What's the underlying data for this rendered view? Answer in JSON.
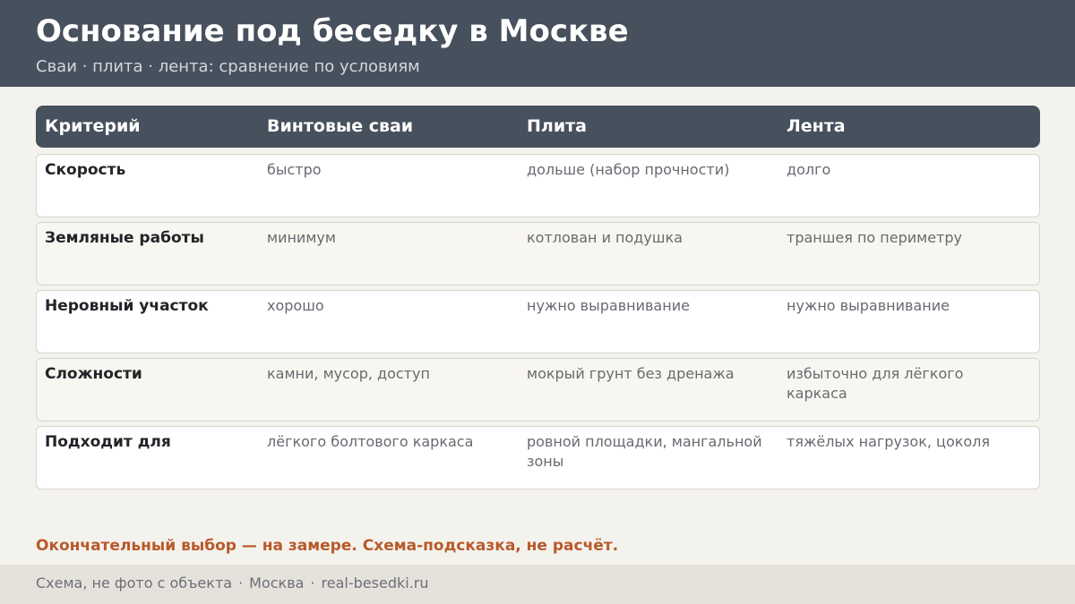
{
  "header": {
    "title": "Основание под беседку в Москве",
    "subtitle": "Сваи · плита · лента: сравнение по условиям"
  },
  "table": {
    "columns": [
      "Критерий",
      "Винтовые сваи",
      "Плита",
      "Лента"
    ],
    "rows": [
      [
        "Скорость",
        "быстро",
        "дольше (набор прочности)",
        "долго"
      ],
      [
        "Земляные работы",
        "минимум",
        "котлован и подушка",
        "траншея по периметру"
      ],
      [
        "Неровный участок",
        "хорошо",
        "нужно выравнивание",
        "нужно выравнивание"
      ],
      [
        "Сложности",
        "камни, мусор, доступ",
        "мокрый грунт без дренажа",
        "избыточно для лёгкого каркаса"
      ],
      [
        "Подходит для",
        "лёгкого болтового каркаса",
        "ровной площадки, мангальной зоны",
        "тяжёлых нагрузок, цоколя"
      ]
    ]
  },
  "note": "Окончательный выбор — на замере. Схема-подсказка, не расчёт.",
  "footer": {
    "parts": [
      "Схема, не фото с объекта",
      "Москва",
      "real-besedki.ru"
    ],
    "separator": "·"
  },
  "colors": {
    "header_bg": "#47505d",
    "accent": "#b8592a",
    "page_bg": "#f4f2ed"
  }
}
